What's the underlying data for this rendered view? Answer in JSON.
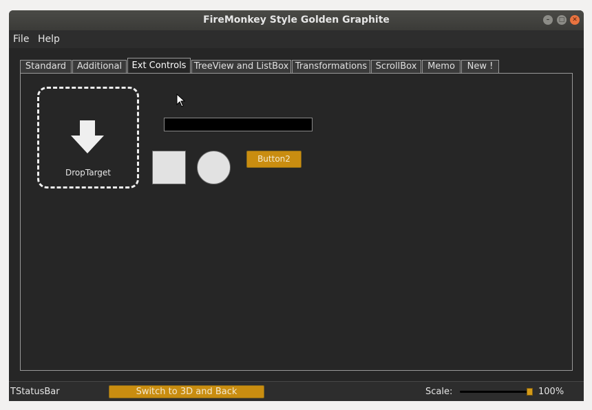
{
  "window": {
    "title": "FireMonkey Style Golden Graphite"
  },
  "menu": {
    "items": [
      "File",
      "Help"
    ]
  },
  "tabs": [
    "Standard",
    "Additional",
    "Ext Controls",
    "TreeView and ListBox",
    "Transformations",
    "ScrollBox",
    "Memo",
    "New !"
  ],
  "active_tab": "Ext Controls",
  "panel": {
    "drop_target_label": "DropTarget",
    "edit_value": "",
    "button2_label": "Button2"
  },
  "statusbar": {
    "label": "TStatusBar",
    "switch_button": "Switch to 3D and Back",
    "scale_label": "Scale:",
    "scale_value": "100%",
    "scale_level_percent": 100
  },
  "colors": {
    "accent": "#c98d10",
    "background": "#262626",
    "menubar": "#2d2d2d",
    "close": "#e9733f"
  },
  "icons": [
    "minimize-icon",
    "maximize-icon",
    "close-icon",
    "arrow-down-icon",
    "mouse-cursor-icon"
  ]
}
